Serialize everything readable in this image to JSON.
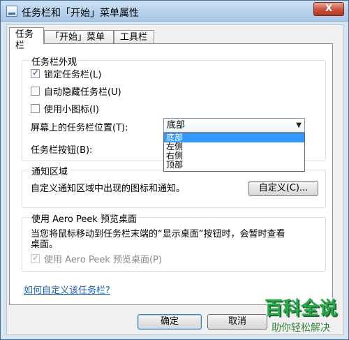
{
  "window": {
    "title": "任务栏和「开始」菜单属性",
    "close_label": "X"
  },
  "tabs": [
    {
      "label": "任务栏",
      "active": true
    },
    {
      "label": "「开始」菜单",
      "active": false
    },
    {
      "label": "工具栏",
      "active": false
    }
  ],
  "appearance": {
    "title": "任务栏外观",
    "lock": {
      "label": "锁定任务栏(L)",
      "checked": true
    },
    "autohide": {
      "label": "自动隐藏任务栏(U)",
      "checked": false
    },
    "small_icons": {
      "label": "使用小图标(I)",
      "checked": false
    },
    "location_label": "屏幕上的任务栏位置(T):",
    "location_value": "底部",
    "location_options": [
      "底部",
      "左侧",
      "右侧",
      "顶部"
    ],
    "buttons_label": "任务栏按钮(B):"
  },
  "notification": {
    "title": "通知区域",
    "description": "自定义通知区域中出现的图标和通知。",
    "customize_button": "自定义(C)..."
  },
  "aero_peek": {
    "title": "使用 Aero Peek 预览桌面",
    "description_line1": "当您将鼠标移动到任务栏末端的“显示桌面”按钮时，会暂时查看",
    "description_line2": "桌面。",
    "checkbox_label": "使用 Aero Peek 预览桌面(P)",
    "checked": true,
    "disabled": true
  },
  "help_link": "如何自定义该任务栏?",
  "footer": {
    "ok": "确定",
    "cancel": "取消"
  },
  "watermark": {
    "title": "百科全说",
    "subtitle": "助你轻松解决"
  }
}
